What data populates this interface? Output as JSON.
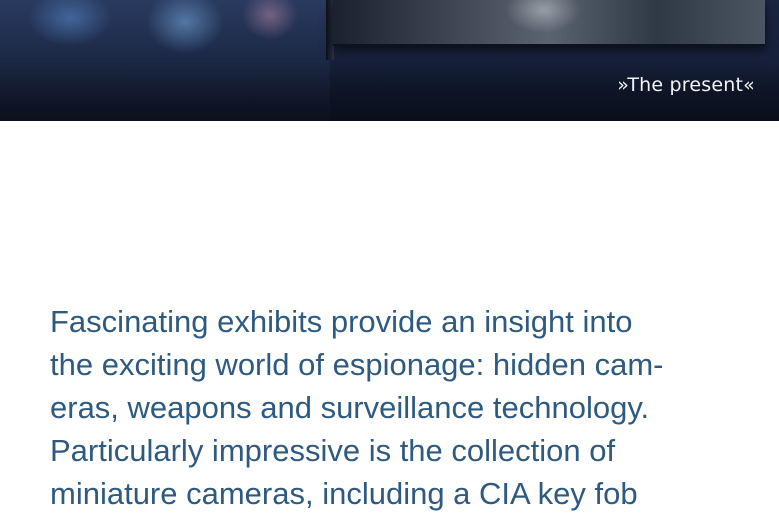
{
  "hero": {
    "caption": "»The present«"
  },
  "content": {
    "lines": [
      "Fascinating exhibits provide an insight into",
      "the exciting world of espionage: hidden cam-",
      "eras, weapons and surveillance technology.",
      "Particularly impressive is the collection of",
      "miniature cameras, including a CIA key fob"
    ]
  },
  "colors": {
    "text": "#2f5a80",
    "caption": "#f2f4f8",
    "background": "#ffffff"
  }
}
